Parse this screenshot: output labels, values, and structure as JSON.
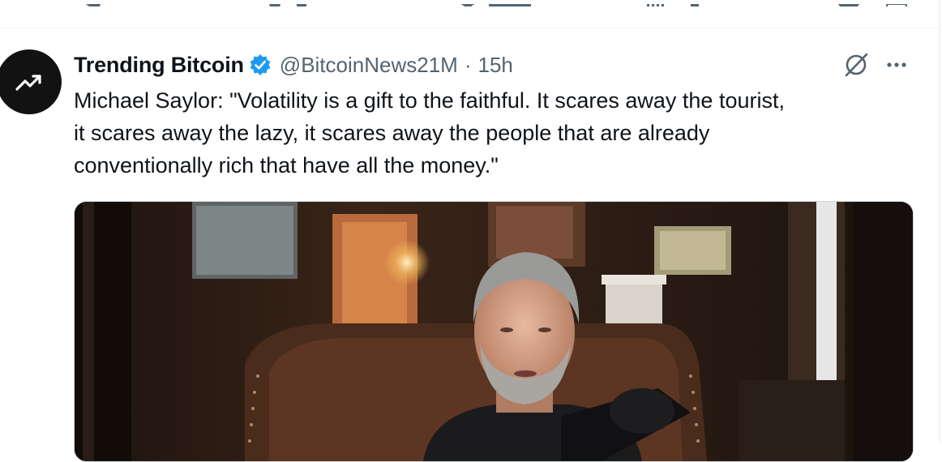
{
  "tweet": {
    "display_name": "Trending Bitcoin",
    "handle": "@BitcoinNews21M",
    "separator": "·",
    "time": "15h",
    "text": "Michael Saylor: \"Volatility is a gift to the faithful. It scares away the tourist,\nit scares away the lazy, it scares away the people that are already\nconventionally rich that have all the money.\""
  },
  "icons": {
    "avatar": "trend-up-icon",
    "verified": "verified-badge-icon",
    "grok": "grok-icon",
    "more": "more-icon"
  },
  "colors": {
    "verified": "#1d9bf0",
    "secondary_text": "#536471",
    "border": "#cfd9de",
    "avatar_bg": "#121212"
  }
}
